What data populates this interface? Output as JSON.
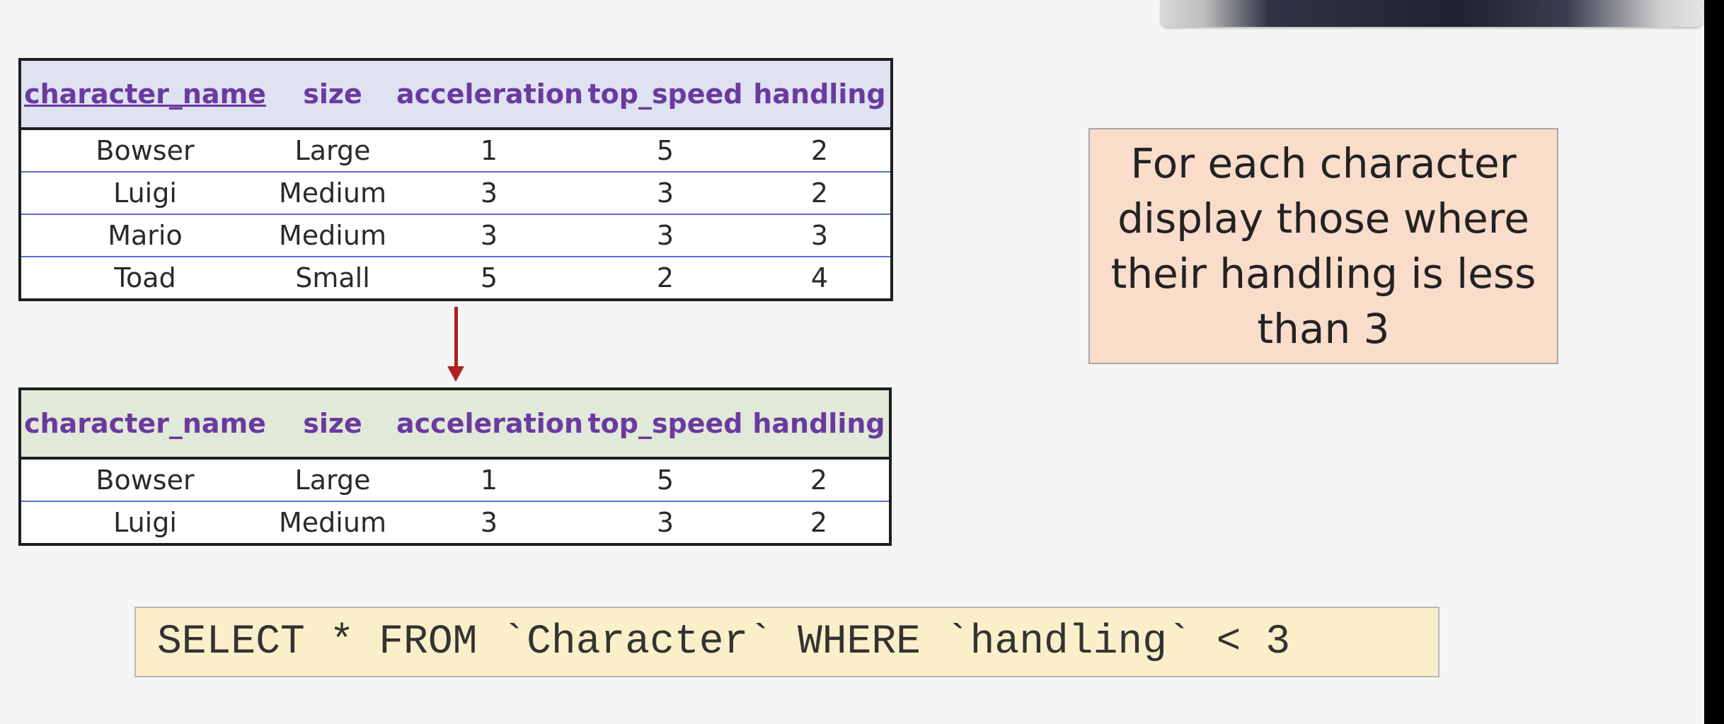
{
  "source_table": {
    "headers": [
      "character_name",
      "size",
      "acceleration",
      "top_speed",
      "handling"
    ],
    "rows": [
      [
        "Bowser",
        "Large",
        "1",
        "5",
        "2"
      ],
      [
        "Luigi",
        "Medium",
        "3",
        "3",
        "2"
      ],
      [
        "Mario",
        "Medium",
        "3",
        "3",
        "3"
      ],
      [
        "Toad",
        "Small",
        "5",
        "2",
        "4"
      ]
    ]
  },
  "result_table": {
    "headers": [
      "character_name",
      "size",
      "acceleration",
      "top_speed",
      "handling"
    ],
    "rows": [
      [
        "Bowser",
        "Large",
        "1",
        "5",
        "2"
      ],
      [
        "Luigi",
        "Medium",
        "3",
        "3",
        "2"
      ]
    ]
  },
  "prompt": {
    "text": "For each character display those where their handling is less than 3"
  },
  "query": {
    "sql": "SELECT * FROM `Character` WHERE `handling` < 3"
  },
  "colors": {
    "header_text": "#6a3aa0",
    "source_header_bg": "#dfe2f1",
    "result_header_bg": "#e1ead8",
    "arrow": "#b0211f",
    "prompt_bg": "#f9dcca",
    "sql_bg": "#fbefc9"
  },
  "icons": [
    "arrow-down-icon"
  ]
}
